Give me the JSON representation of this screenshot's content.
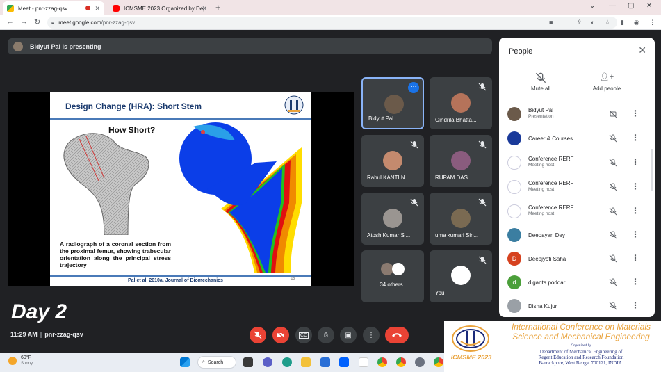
{
  "browser": {
    "tabs": [
      {
        "title": "Meet - pnr-zzag-qsv",
        "active": true
      },
      {
        "title": "ICMSME 2023 Organized by Dep",
        "active": false
      }
    ],
    "url_host": "meet.google.com",
    "url_path": "/pnr-zzag-qsv"
  },
  "meet": {
    "presenting_banner": "Bidyut Pal is presenting",
    "time": "11:29 AM",
    "separator": "|",
    "meeting_code": "pnr-zzag-qsv",
    "overlay_label": "Day 2"
  },
  "slide": {
    "title": "Design Change (HRA): Short Stem",
    "subtitle": "How Short?",
    "caption": "A radiograph of a coronal section from the proximal femur, showing trabecular orientation along the principal stress trajectory",
    "citation": "Pal et al. 2010a, Journal of Biomechanics",
    "page": "18"
  },
  "tiles": [
    {
      "name": "Bidyut Pal",
      "active": true,
      "avatar_color": "#6b5a4a"
    },
    {
      "name": "Oindrila Bhatta...",
      "active": false,
      "avatar_color": "#b5735a"
    },
    {
      "name": "Rahul KANTI N...",
      "active": false,
      "avatar_color": "#c48a6e"
    },
    {
      "name": "RUPAM DAS",
      "active": false,
      "avatar_color": "#8a5c7e"
    },
    {
      "name": "Atosh Kumar Si...",
      "active": false,
      "avatar_color": "#9a9591"
    },
    {
      "name": "uma kumari Sin...",
      "active": false,
      "avatar_color": "#7a6a52"
    },
    {
      "name": "34 others",
      "active": false,
      "avatar_color": "#8a7a70"
    },
    {
      "name": "You",
      "active": false,
      "avatar_color": "#ffffff"
    }
  ],
  "people_panel": {
    "title": "People",
    "mute_all": "Mute all",
    "add_people": "Add people",
    "participants": [
      {
        "name": "Bidyut Pal",
        "role": "Presentation",
        "avatar_color": "#6b5a4a",
        "initial": ""
      },
      {
        "name": "Career & Courses",
        "role": "",
        "avatar_color": "#1a3a9a",
        "initial": ""
      },
      {
        "name": "Conference RERF",
        "role": "Meeting host",
        "avatar_color": "#ffffff",
        "initial": ""
      },
      {
        "name": "Conference RERF",
        "role": "Meeting host",
        "avatar_color": "#ffffff",
        "initial": ""
      },
      {
        "name": "Conference RERF",
        "role": "Meeting host",
        "avatar_color": "#ffffff",
        "initial": ""
      },
      {
        "name": "Deepayan Dey",
        "role": "",
        "avatar_color": "#3b7ea1",
        "initial": ""
      },
      {
        "name": "Deepjyoti Saha",
        "role": "",
        "avatar_color": "#d6421f",
        "initial": "D"
      },
      {
        "name": "diganta poddar",
        "role": "",
        "avatar_color": "#4b9f3a",
        "initial": "d"
      },
      {
        "name": "Disha Kujur",
        "role": "",
        "avatar_color": "#9aa0a6",
        "initial": ""
      }
    ]
  },
  "taskbar": {
    "temperature": "60°F",
    "condition": "Sunny",
    "search": "Search"
  },
  "banner": {
    "title": "International Conference on Materials Science and Mechanical Engineering",
    "organized_by": "Organized by",
    "dept_line1": "Department of Mechanical Engineering of",
    "dept_line2": "Regent Education and Research Foundation",
    "dept_line3": "Barrackpore, West Bengal 700121, INDIA.",
    "logo_text": "ICMSME 2023"
  },
  "colors": {
    "meet_bg": "#202124",
    "tile_bg": "#3c4043",
    "accent_blue": "#8ab4f8",
    "end_call_red": "#ea4335",
    "banner_orange": "#e9a23b",
    "banner_navy": "#1b2a7a"
  }
}
